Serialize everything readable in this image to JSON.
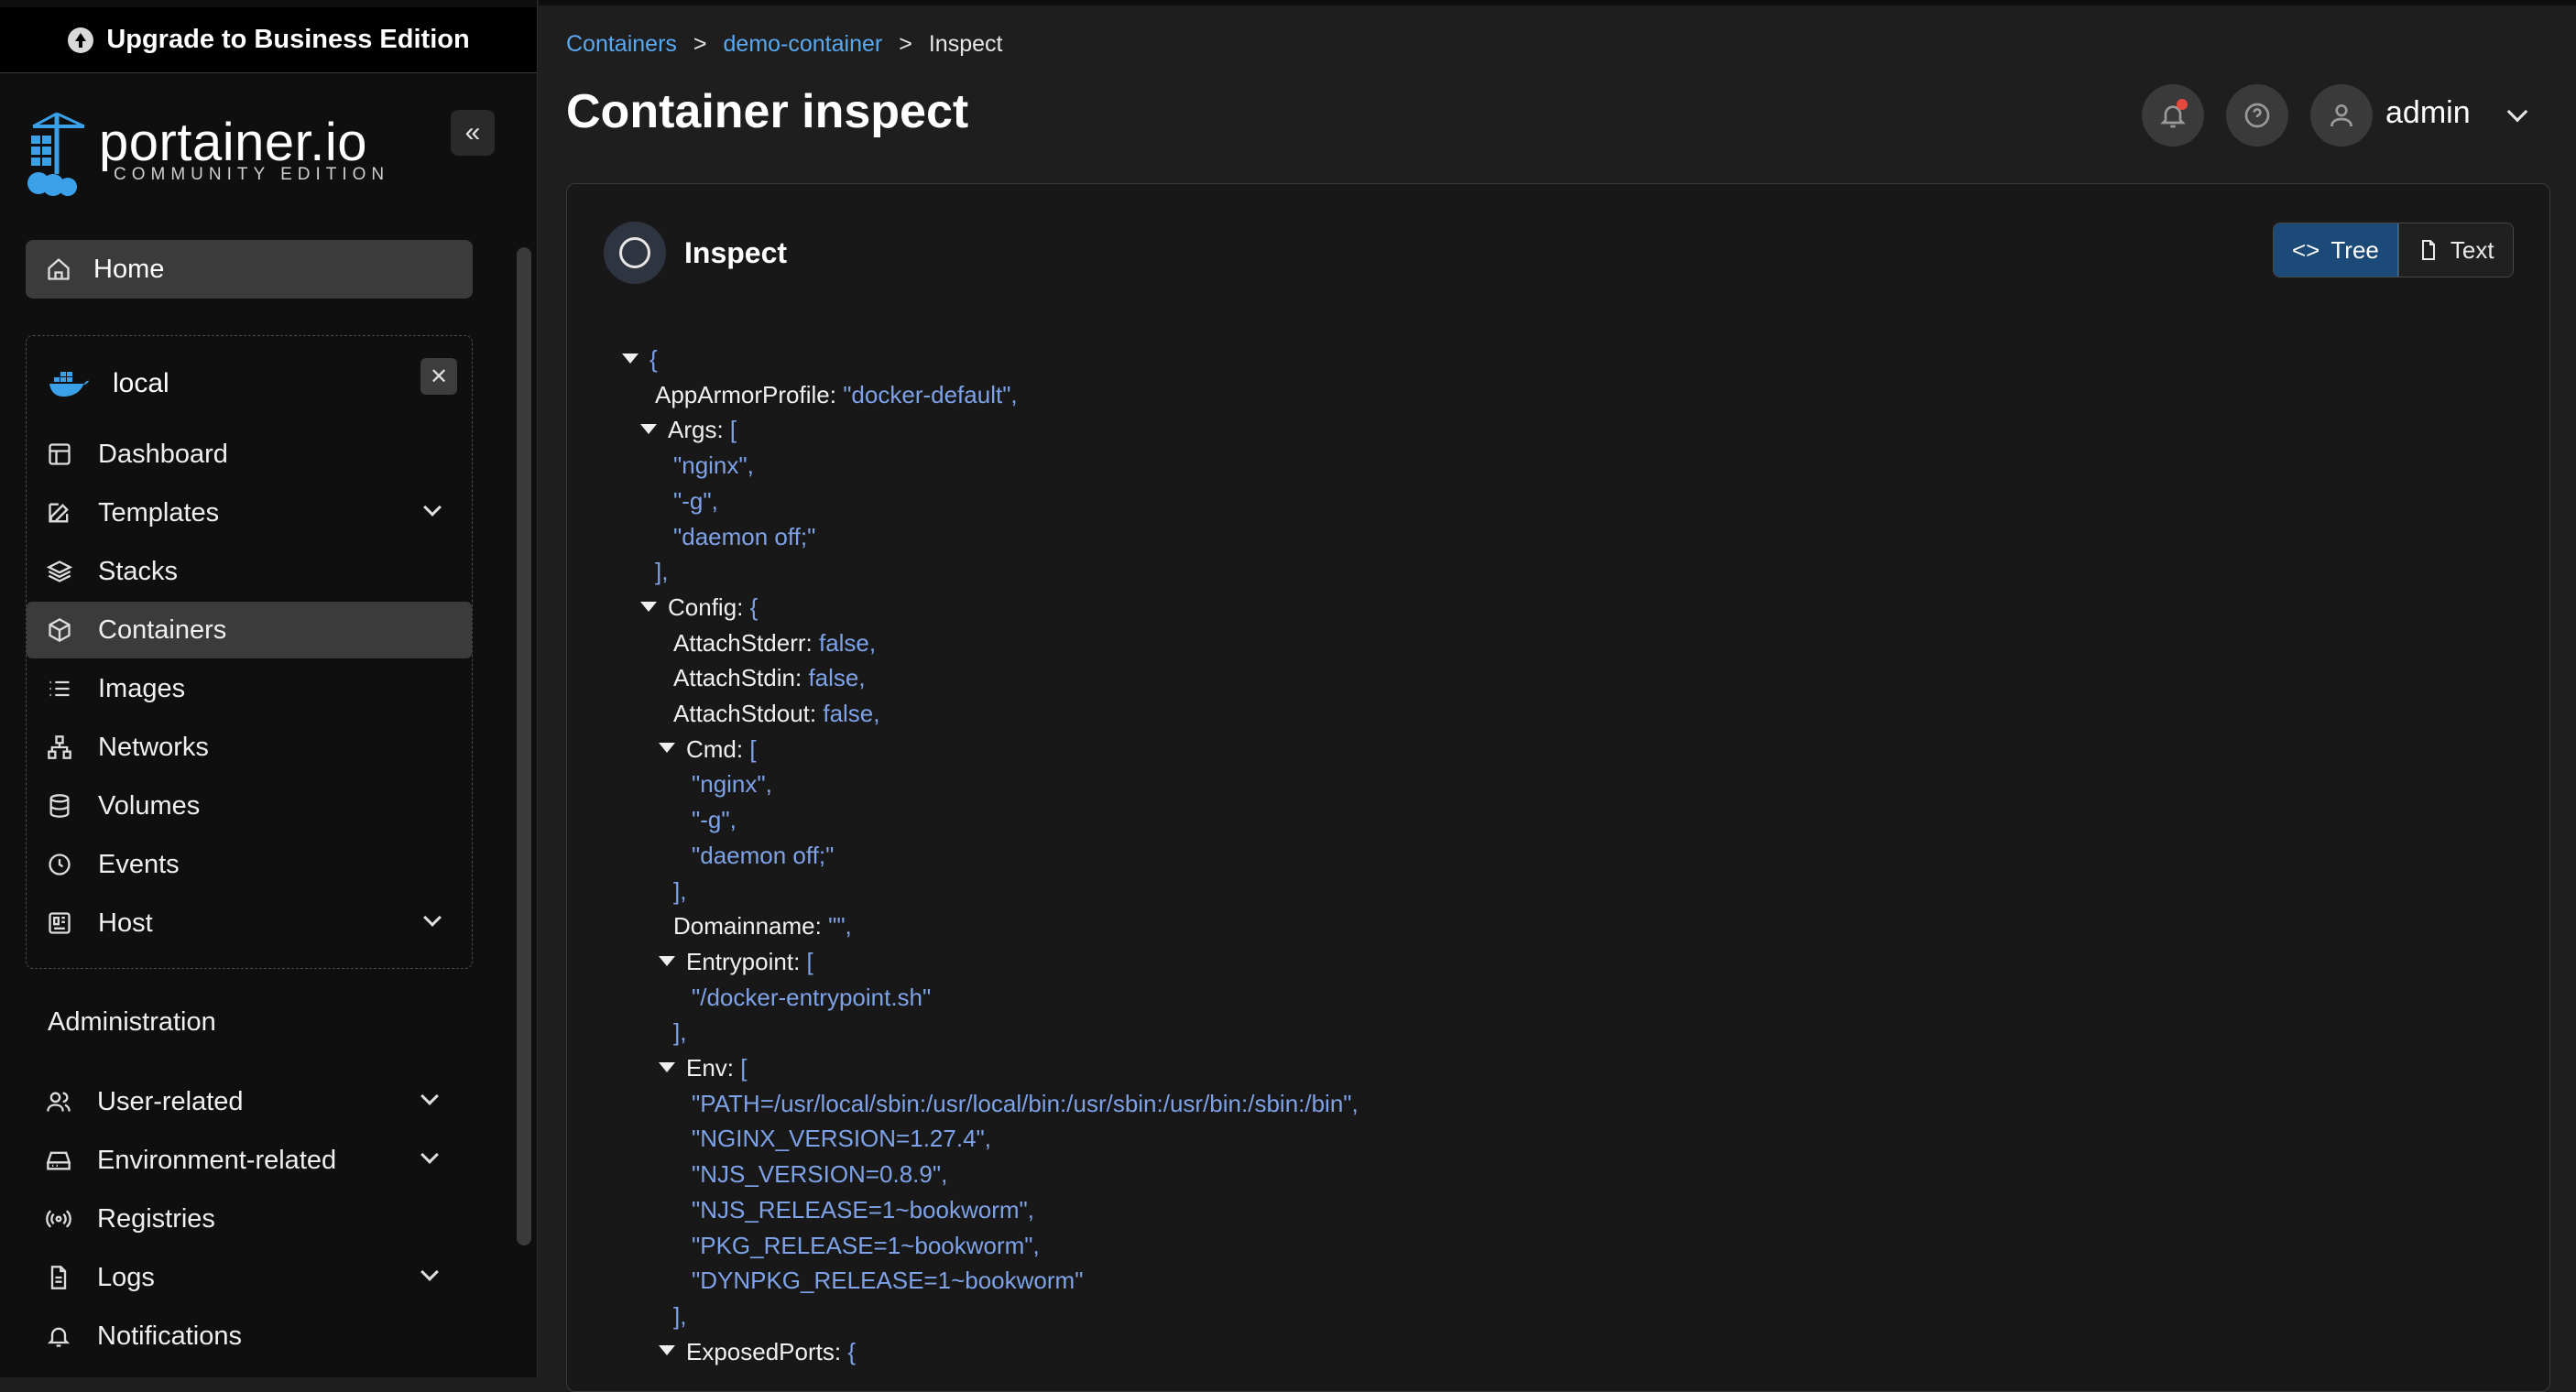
{
  "upgrade_banner": {
    "label": "Upgrade to Business Edition"
  },
  "brand": {
    "name": "portainer.io",
    "edition": "COMMUNITY EDITION"
  },
  "sidebar": {
    "home_label": "Home",
    "environment": {
      "name": "local",
      "items": [
        {
          "label": "Dashboard",
          "icon": "dashboard-icon",
          "expandable": false
        },
        {
          "label": "Templates",
          "icon": "edit-icon",
          "expandable": true
        },
        {
          "label": "Stacks",
          "icon": "layers-icon",
          "expandable": false
        },
        {
          "label": "Containers",
          "icon": "box-icon",
          "expandable": false,
          "active": true
        },
        {
          "label": "Images",
          "icon": "list-icon",
          "expandable": false
        },
        {
          "label": "Networks",
          "icon": "network-icon",
          "expandable": false
        },
        {
          "label": "Volumes",
          "icon": "database-icon",
          "expandable": false
        },
        {
          "label": "Events",
          "icon": "clock-icon",
          "expandable": false
        },
        {
          "label": "Host",
          "icon": "host-icon",
          "expandable": true
        }
      ]
    },
    "administration": {
      "title": "Administration",
      "items": [
        {
          "label": "User-related",
          "icon": "users-icon",
          "expandable": true
        },
        {
          "label": "Environment-related",
          "icon": "drive-icon",
          "expandable": true
        },
        {
          "label": "Registries",
          "icon": "radio-icon",
          "expandable": false
        },
        {
          "label": "Logs",
          "icon": "file-icon",
          "expandable": true
        },
        {
          "label": "Notifications",
          "icon": "bell-icon",
          "expandable": false
        }
      ]
    }
  },
  "breadcrumb": {
    "root": "Containers",
    "item": "demo-container",
    "current": "Inspect",
    "separator": ">"
  },
  "header": {
    "title": "Container inspect",
    "user": "admin"
  },
  "panel": {
    "title": "Inspect",
    "tree_label": "Tree",
    "text_label": "Text"
  },
  "tree": [
    {
      "key": "",
      "value": "{",
      "caret": true,
      "indent": 0
    },
    {
      "key": "AppArmorProfile:",
      "value": "\"docker-default\",",
      "caret": false,
      "indent": 1
    },
    {
      "key": "Args:",
      "value": "[",
      "caret": true,
      "indent": 1
    },
    {
      "key": "",
      "value": "\"nginx\",",
      "caret": false,
      "indent": 2
    },
    {
      "key": "",
      "value": "\"-g\",",
      "caret": false,
      "indent": 2
    },
    {
      "key": "",
      "value": "\"daemon off;\"",
      "caret": false,
      "indent": 2
    },
    {
      "key": "",
      "value": "],",
      "caret": false,
      "indent": 1
    },
    {
      "key": "Config:",
      "value": "{",
      "caret": true,
      "indent": 1
    },
    {
      "key": "AttachStderr:",
      "value": "false,",
      "caret": false,
      "indent": 2
    },
    {
      "key": "AttachStdin:",
      "value": "false,",
      "caret": false,
      "indent": 2
    },
    {
      "key": "AttachStdout:",
      "value": "false,",
      "caret": false,
      "indent": 2
    },
    {
      "key": "Cmd:",
      "value": "[",
      "caret": true,
      "indent": 2
    },
    {
      "key": "",
      "value": "\"nginx\",",
      "caret": false,
      "indent": 3
    },
    {
      "key": "",
      "value": "\"-g\",",
      "caret": false,
      "indent": 3
    },
    {
      "key": "",
      "value": "\"daemon off;\"",
      "caret": false,
      "indent": 3
    },
    {
      "key": "",
      "value": "],",
      "caret": false,
      "indent": 2
    },
    {
      "key": "Domainname:",
      "value": "\"\",",
      "caret": false,
      "indent": 2
    },
    {
      "key": "Entrypoint:",
      "value": "[",
      "caret": true,
      "indent": 2
    },
    {
      "key": "",
      "value": "\"/docker-entrypoint.sh\"",
      "caret": false,
      "indent": 3
    },
    {
      "key": "",
      "value": "],",
      "caret": false,
      "indent": 2
    },
    {
      "key": "Env:",
      "value": "[",
      "caret": true,
      "indent": 2
    },
    {
      "key": "",
      "value": "\"PATH=/usr/local/sbin:/usr/local/bin:/usr/sbin:/usr/bin:/sbin:/bin\",",
      "caret": false,
      "indent": 3
    },
    {
      "key": "",
      "value": "\"NGINX_VERSION=1.27.4\",",
      "caret": false,
      "indent": 3
    },
    {
      "key": "",
      "value": "\"NJS_VERSION=0.8.9\",",
      "caret": false,
      "indent": 3
    },
    {
      "key": "",
      "value": "\"NJS_RELEASE=1~bookworm\",",
      "caret": false,
      "indent": 3
    },
    {
      "key": "",
      "value": "\"PKG_RELEASE=1~bookworm\",",
      "caret": false,
      "indent": 3
    },
    {
      "key": "",
      "value": "\"DYNPKG_RELEASE=1~bookworm\"",
      "caret": false,
      "indent": 3
    },
    {
      "key": "",
      "value": "],",
      "caret": false,
      "indent": 2
    },
    {
      "key": "ExposedPorts:",
      "value": "{",
      "caret": true,
      "indent": 2
    }
  ]
}
